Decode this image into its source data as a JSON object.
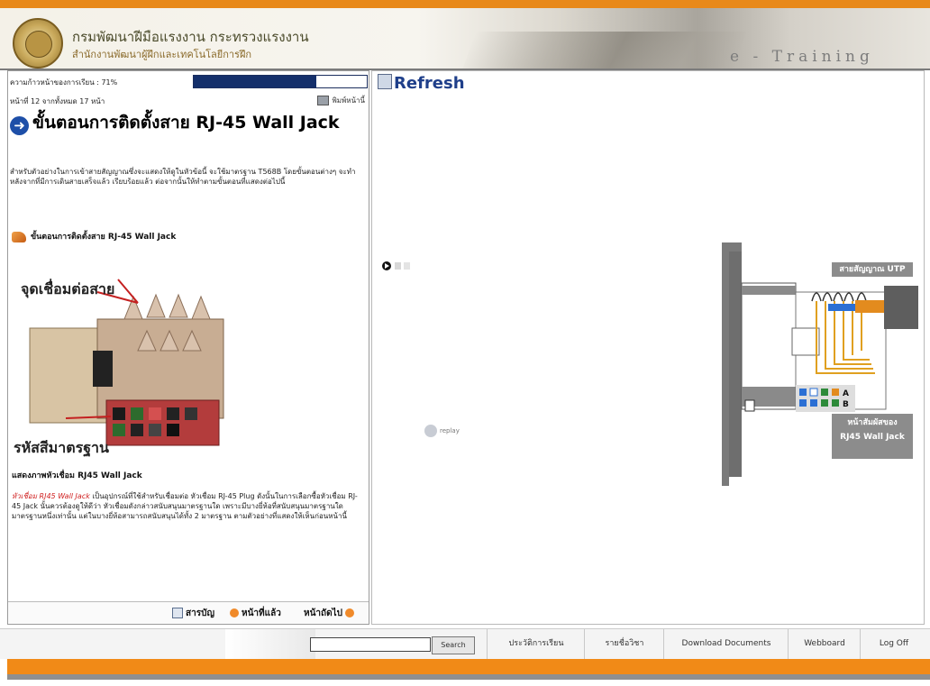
{
  "header": {
    "org_line1": "กรมพัฒนาฝีมือแรงงาน กระทรวงแรงงาน",
    "org_line2": "สำนักงานพัฒนาผู้ฝึกและเทคโนโลยีการฝึก",
    "brand": "e - Training"
  },
  "progress": {
    "label": "ความก้าวหน้าของการเรียน : 71%",
    "percent": 71
  },
  "page_counter": "หน้าที่ 12 จากทั้งหมด 17 หน้า",
  "print_label": "พิมพ์หน้านี้",
  "lesson": {
    "title": "ขั้นตอนการติดตั้งสาย RJ-45 Wall Jack",
    "intro": "สำหรับตัวอย่างในการเข้าสายสัญญาณซึ่งจะแสดงให้ดูในหัวข้อนี้ จะใช้มาตรฐาน T568B โดยขั้นตอนต่างๆ จะทำหลังจากที่มีการเดินสายเสร็จแล้ว เรียบร้อยแล้ว ต่อจากนั้นให้ทำตามขั้นตอนที่แสดงต่อไปนี้",
    "step_heading": "ขั้นตอนการติดตั้งสาย RJ-45 Wall Jack",
    "image_labels": {
      "connection_point": "จุดเชื่อมต่อสาย",
      "standard_code": "รหัสสีมาตรฐาน"
    },
    "caption": "แสดงภาพหัวเชื่อม RJ45 Wall Jack",
    "desc_red": "หัวเชื่อม RJ45 Wall Jack",
    "desc_rest": " เป็นอุปกรณ์ที่ใช้สำหรับเชื่อมต่อ หัวเชื่อม RJ-45 Plug ดังนั้นในการเลือกซื้อหัวเชื่อม RJ-45 Jack นั้นควรต้องดูให้ดีว่า หัวเชื่อมดังกล่าวสนับสนุนมาตรฐานใด เพราะมีบางยี่ห้อที่สนับสนุนมาตรฐานใดมาตรฐานหนึ่งเท่านั้น แต่ในบางยี่ห้อสามารถสนับสนุนได้ทั้ง 2 มาตรฐาน ตามตัวอย่างที่แสดงให้เห็นก่อนหน้านี้"
  },
  "nav": {
    "contents": "สารบัญ",
    "previous": "หน้าที่แล้ว",
    "next": "หน้าถัดไป"
  },
  "right": {
    "refresh": "Refresh",
    "replay": "replay",
    "utp_label": "สายสัญญาณ UTP",
    "face_label_1": "หน้าสัมผัสของ",
    "face_label_2": "RJ45 Wall Jack"
  },
  "toolbar": {
    "search_value": "",
    "search_button": "Search",
    "items": [
      "ประวัติการเรียน",
      "รายชื่อวิชา",
      "Download Documents",
      "Webboard",
      "Log Off"
    ]
  },
  "colors": {
    "accent_orange": "#f18a17",
    "progress_blue": "#142f6b",
    "link_blue": "#1f3f8a"
  }
}
